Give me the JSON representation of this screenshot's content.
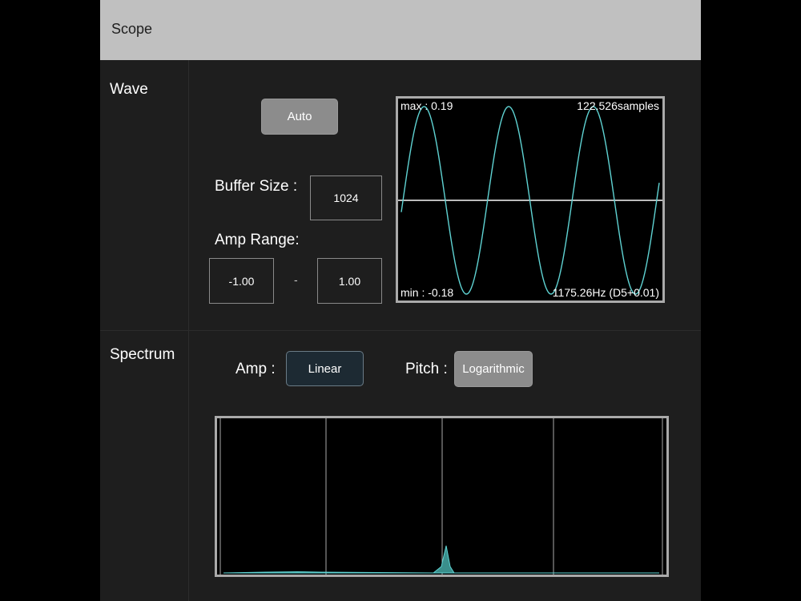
{
  "app": {
    "title": "Scope"
  },
  "wave": {
    "section_label": "Wave",
    "auto_label": "Auto",
    "buffer_size_label": "Buffer Size :",
    "buffer_size_value": "1024",
    "amp_range_label": "Amp Range:",
    "amp_min": "-1.00",
    "amp_separator": "-",
    "amp_max": "1.00",
    "display": {
      "max_text": "max : 0.19",
      "samples_text": "122.526samples",
      "min_text": "min : -0.18",
      "freq_text": "1175.26Hz (D5+0.01)",
      "amplitude": 0.19,
      "period_samples": 122.526,
      "wave_color": "#5fd3d3"
    }
  },
  "spectrum": {
    "section_label": "Spectrum",
    "amp_label": "Amp :",
    "amp_mode": "Linear",
    "pitch_label": "Pitch :",
    "pitch_mode": "Logarithmic",
    "peak_color": "#5fd3d3"
  },
  "colors": {
    "panel_bg": "#1e1e1e",
    "header_bg": "#c0c0c0",
    "button_gray": "#8c8c8c",
    "button_dark": "#1d2a33"
  }
}
